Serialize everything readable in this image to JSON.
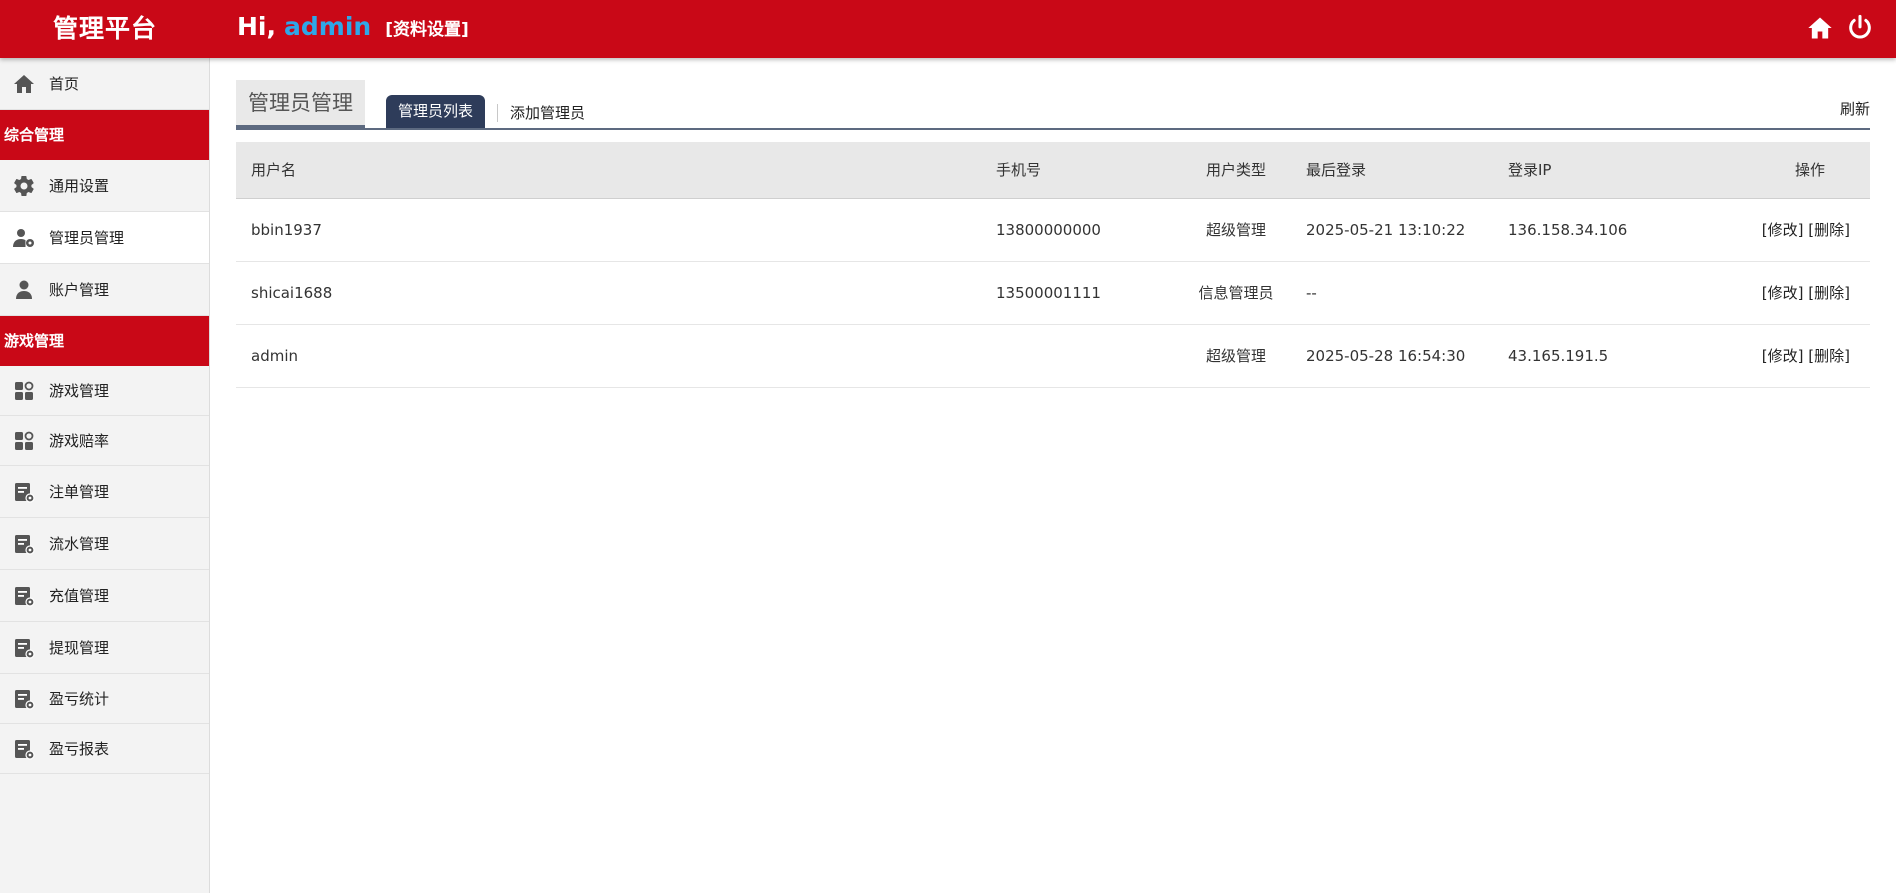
{
  "header": {
    "brand": "管理平台",
    "greeting_prefix": "Hi,",
    "username": "admin",
    "profile_link": "[资料设置]"
  },
  "sidebar": {
    "home": "首页",
    "group1": "综合管理",
    "general_settings": "通用设置",
    "admin_management": "管理员管理",
    "account_management": "账户管理",
    "group2": "游戏管理",
    "game_management": "游戏管理",
    "game_odds": "游戏赔率",
    "bet_management": "注单管理",
    "flow_management": "流水管理",
    "recharge_management": "充值管理",
    "withdraw_management": "提现管理",
    "profit_stats": "盈亏统计",
    "profit_report": "盈亏报表"
  },
  "main": {
    "page_title": "管理员管理",
    "tab_list": "管理员列表",
    "tab_add": "添加管理员",
    "refresh": "刷新"
  },
  "table": {
    "headers": {
      "username": "用户名",
      "phone": "手机号",
      "user_type": "用户类型",
      "last_login": "最后登录",
      "login_ip": "登录IP",
      "actions": "操作"
    },
    "rows": [
      {
        "username": "bbin1937",
        "phone": "13800000000",
        "user_type": "超级管理",
        "last_login": "2025-05-21 13:10:22",
        "login_ip": "136.158.34.106",
        "edit": "[修改]",
        "delete": "[删除]"
      },
      {
        "username": "shicai1688",
        "phone": "13500001111",
        "user_type": "信息管理员",
        "last_login": "--",
        "login_ip": "",
        "edit": "[修改]",
        "delete": "[删除]"
      },
      {
        "username": "admin",
        "phone": "",
        "user_type": "超级管理",
        "last_login": "2025-05-28 16:54:30",
        "login_ip": "43.165.191.5",
        "edit": "[修改]",
        "delete": "[删除]"
      }
    ]
  },
  "colors": {
    "primary_red": "#c90817",
    "username_blue": "#2ea7e8",
    "tab_dark": "#2e3c5a"
  }
}
